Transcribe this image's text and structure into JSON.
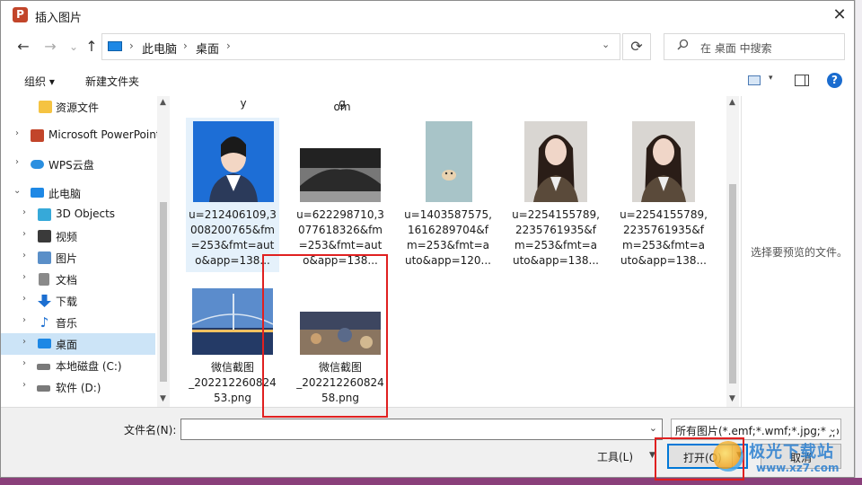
{
  "window": {
    "title": "插入图片",
    "app_icon_letter": "P",
    "close": "✕"
  },
  "nav": {
    "back": "←",
    "forward": "→",
    "recent": "⌄",
    "up": "↑",
    "refresh": "⟳"
  },
  "address": {
    "separator": "›",
    "crumbs": [
      "此电脑",
      "桌面"
    ],
    "dropdown": "⌄"
  },
  "search": {
    "icon": "search-icon",
    "placeholder": "在 桌面 中搜索"
  },
  "toolbar": {
    "organize": "组织 ▾",
    "new_folder": "新建文件夹",
    "view_caret": "▾",
    "help": "?"
  },
  "sidebar": {
    "items": [
      {
        "label": "资源文件",
        "icon": "folder-icon",
        "color": "#f5c342"
      },
      {
        "label": "Microsoft PowerPoint",
        "icon": "powerpoint-icon",
        "color": "#c2452a"
      },
      {
        "label": "WPS云盘",
        "icon": "cloud-icon",
        "color": "#2a8fe0"
      },
      {
        "label": "此电脑",
        "icon": "computer-icon",
        "color": "#1e88e5"
      },
      {
        "label": "3D Objects",
        "icon": "cube-icon",
        "color": "#36a9d9"
      },
      {
        "label": "视频",
        "icon": "video-icon",
        "color": "#3a3a3a"
      },
      {
        "label": "图片",
        "icon": "pictures-icon",
        "color": "#5a8fc8"
      },
      {
        "label": "文档",
        "icon": "document-icon",
        "color": "#8a8a8a"
      },
      {
        "label": "下载",
        "icon": "download-icon",
        "color": "#1c6fd1"
      },
      {
        "label": "音乐",
        "icon": "music-icon",
        "color": "#1c6fd1"
      },
      {
        "label": "桌面",
        "icon": "desktop-icon",
        "color": "#1e88e5"
      },
      {
        "label": "本地磁盘 (C:)",
        "icon": "drive-c-icon",
        "color": "#7a7a7a"
      },
      {
        "label": "软件 (D:)",
        "icon": "drive-d-icon",
        "color": "#7a7a7a"
      }
    ],
    "expander": "›",
    "expander_open": "⌄"
  },
  "files": {
    "partial_top": [
      "y",
      "g",
      "om"
    ],
    "tiles": [
      {
        "lines": [
          "u=212406109,3",
          "008200765&fm",
          "=253&fmt=aut",
          "o&app=138..."
        ],
        "thumb_color": "#1d6ed6"
      },
      {
        "lines": [
          "u=622298710,3",
          "077618326&fm",
          "=253&fmt=aut",
          "o&app=138..."
        ],
        "thumb_color": "#555555"
      },
      {
        "lines": [
          "u=1403587575,",
          "1616289704&f",
          "m=253&fmt=a",
          "uto&app=120..."
        ],
        "thumb_color": "#a8c4c8"
      },
      {
        "lines": [
          "u=2254155789,",
          "2235761935&f",
          "m=253&fmt=a",
          "uto&app=138..."
        ],
        "thumb_color": "#d9d6d2"
      },
      {
        "lines": [
          "u=2254155789,",
          "2235761935&f",
          "m=253&fmt=a",
          "uto&app=138..."
        ],
        "thumb_color": "#d9d6d2"
      },
      {
        "lines": [
          "微信截图",
          "_202212260824",
          "53.png"
        ],
        "thumb_color": "#4f7fbf"
      },
      {
        "lines": [
          "微信截图",
          "_202212260824",
          "58.png"
        ],
        "thumb_color": "#6b6e7a"
      }
    ]
  },
  "preview": {
    "empty_text": "选择要预览的文件。"
  },
  "bottom": {
    "filename_label": "文件名(N):",
    "filename_value": "",
    "filter_value": "所有图片(*.emf;*.wmf;*.jpg;*.jp",
    "tools_label": "工具(L)",
    "open_label": "打开(O)",
    "cancel_label": "取消"
  },
  "watermark": {
    "line1": "极光下载站",
    "line2": "www.xz7.com"
  },
  "colors": {
    "accent": "#0078d7",
    "selection": "#cce4f7",
    "annotation": "#e02020"
  }
}
